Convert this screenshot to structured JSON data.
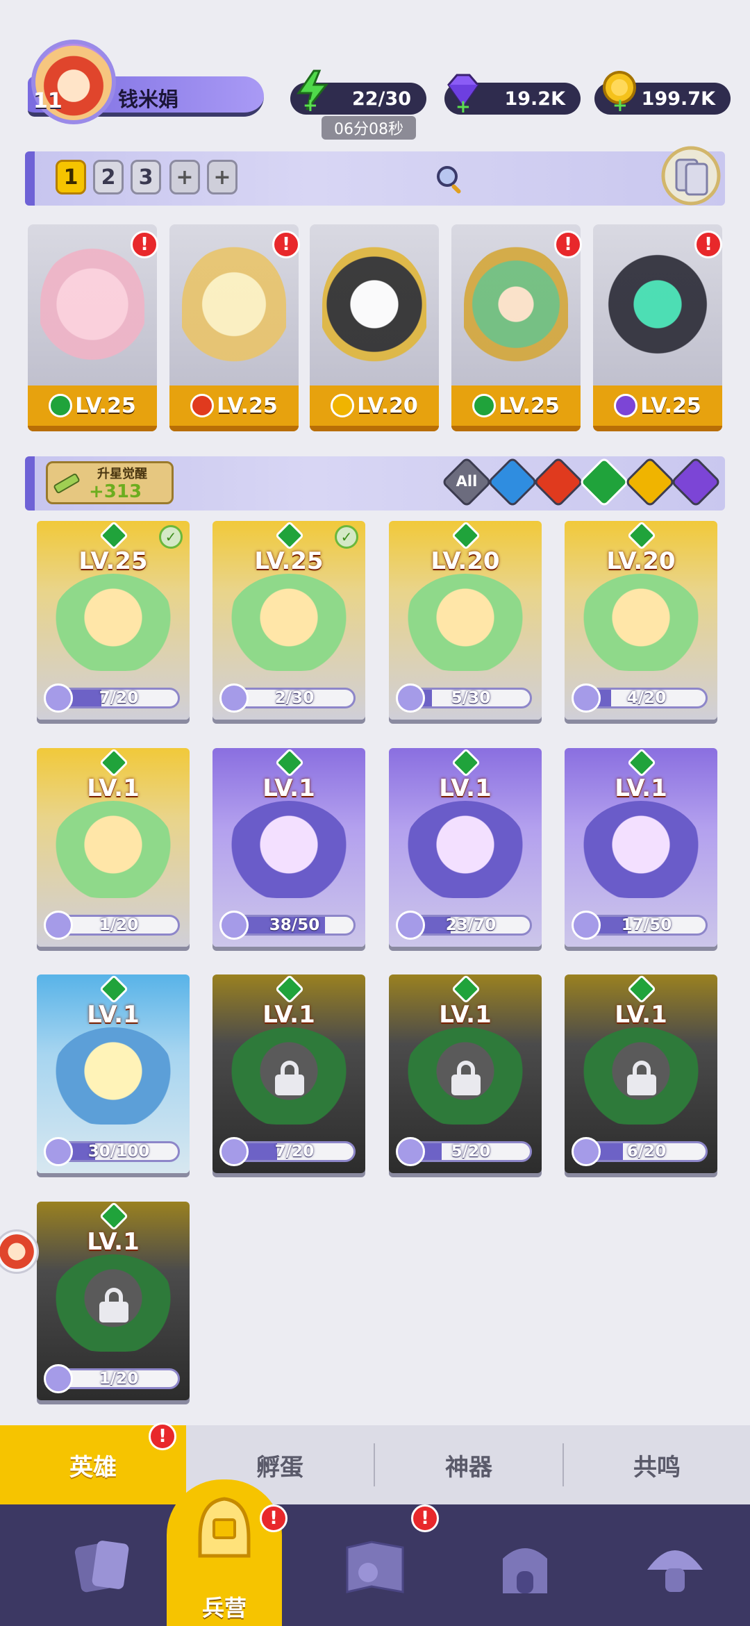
{
  "player": {
    "level": "11",
    "name": "钱米娟"
  },
  "resources": {
    "energy": "22/30",
    "energy_timer": "06分08秒",
    "gems": "19.2K",
    "gold": "199.7K"
  },
  "teams": {
    "tabs": [
      "1",
      "2",
      "3",
      "+",
      "+"
    ],
    "active_tab": "1"
  },
  "formation": [
    {
      "level": "LV.25",
      "element": "wind",
      "alert": true
    },
    {
      "level": "LV.25",
      "element": "fire",
      "alert": true
    },
    {
      "level": "LV.20",
      "element": "light",
      "alert": false
    },
    {
      "level": "LV.25",
      "element": "wind",
      "alert": true
    },
    {
      "level": "LV.25",
      "element": "dark",
      "alert": true
    }
  ],
  "awaken": {
    "title": "升星觉醒",
    "value": "+313"
  },
  "filters": [
    "All",
    "water",
    "fire",
    "wind",
    "light",
    "dark"
  ],
  "heroes": [
    {
      "level": "LV.25",
      "progress": "7/20",
      "ratio": 0.35,
      "bg": "gold",
      "checked": true,
      "locked": false
    },
    {
      "level": "LV.25",
      "progress": "2/30",
      "ratio": 0.07,
      "bg": "gold",
      "checked": true,
      "locked": false
    },
    {
      "level": "LV.20",
      "progress": "5/30",
      "ratio": 0.17,
      "bg": "gold",
      "checked": false,
      "locked": false
    },
    {
      "level": "LV.20",
      "progress": "4/20",
      "ratio": 0.2,
      "bg": "gold",
      "checked": false,
      "locked": false
    },
    {
      "level": "LV.1",
      "progress": "1/20",
      "ratio": 0.05,
      "bg": "gold",
      "checked": false,
      "locked": false
    },
    {
      "level": "LV.1",
      "progress": "38/50",
      "ratio": 0.76,
      "bg": "purple",
      "checked": false,
      "locked": false
    },
    {
      "level": "LV.1",
      "progress": "23/70",
      "ratio": 0.33,
      "bg": "purple",
      "checked": false,
      "locked": false
    },
    {
      "level": "LV.1",
      "progress": "17/50",
      "ratio": 0.34,
      "bg": "purple",
      "checked": false,
      "locked": false
    },
    {
      "level": "LV.1",
      "progress": "30/100",
      "ratio": 0.3,
      "bg": "blue",
      "checked": false,
      "locked": false
    },
    {
      "level": "LV.1",
      "progress": "7/20",
      "ratio": 0.35,
      "bg": "locked",
      "checked": false,
      "locked": true
    },
    {
      "level": "LV.1",
      "progress": "5/20",
      "ratio": 0.25,
      "bg": "locked",
      "checked": false,
      "locked": true
    },
    {
      "level": "LV.1",
      "progress": "6/20",
      "ratio": 0.3,
      "bg": "locked",
      "checked": false,
      "locked": true
    },
    {
      "level": "LV.1",
      "progress": "1/20",
      "ratio": 0.05,
      "bg": "locked",
      "checked": false,
      "locked": true
    }
  ],
  "subtabs": {
    "heroes": "英雄",
    "hatch": "孵蛋",
    "artifact": "神器",
    "resonance": "共鸣"
  },
  "nav": {
    "barracks": "兵营"
  },
  "colors": {
    "accent": "#f6c400",
    "nav_bg": "#3c3863",
    "alert": "#e8282b",
    "wind": "#20a33b",
    "fire": "#e03a1e",
    "water": "#2f8de0",
    "light": "#f0b400",
    "dark": "#7c45d6"
  }
}
